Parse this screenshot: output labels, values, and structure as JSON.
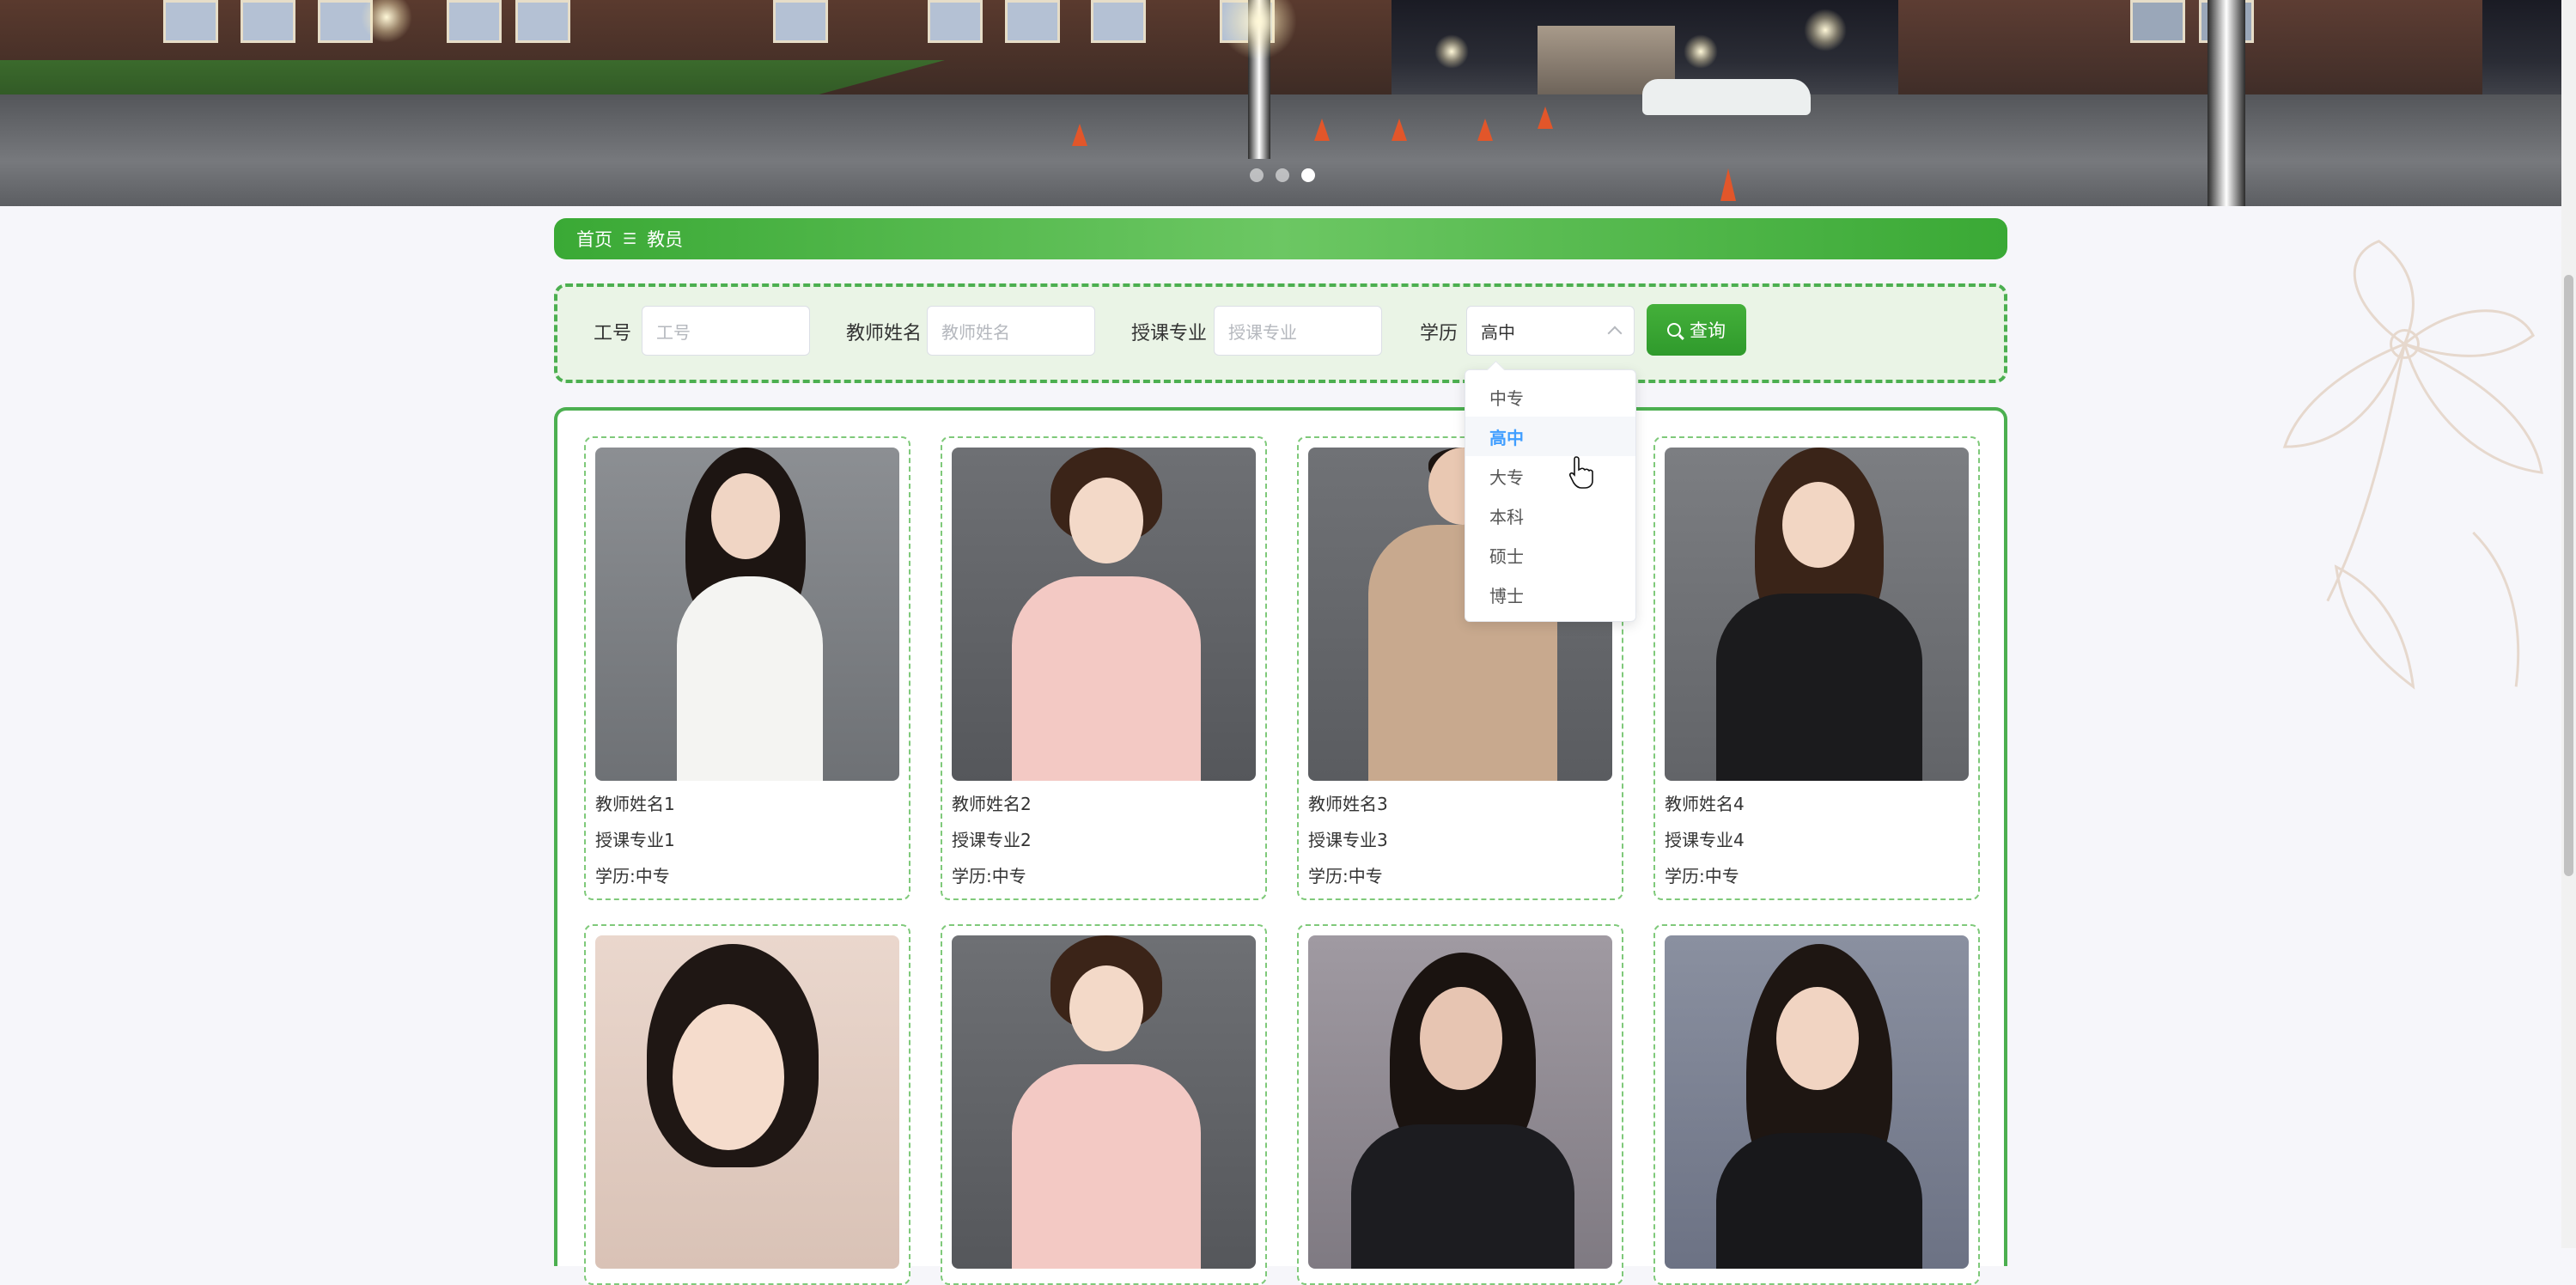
{
  "breadcrumb": {
    "home": "首页",
    "separator": "☰",
    "current": "教员"
  },
  "search": {
    "fields": [
      {
        "label": "工号",
        "placeholder": "工号"
      },
      {
        "label": "教师姓名",
        "placeholder": "教师姓名"
      },
      {
        "label": "授课专业",
        "placeholder": "授课专业"
      }
    ],
    "education": {
      "label": "学历",
      "value": "高中"
    },
    "button_label": "查询"
  },
  "dropdown": {
    "options": [
      "中专",
      "高中",
      "大专",
      "本科",
      "硕士",
      "博士"
    ],
    "selected": "高中"
  },
  "teachers": [
    {
      "name": "教师姓名1",
      "major": "授课专业1",
      "education": "学历:中专"
    },
    {
      "name": "教师姓名2",
      "major": "授课专业2",
      "education": "学历:中专"
    },
    {
      "name": "教师姓名3",
      "major": "授课专业3",
      "education": "学历:中专"
    },
    {
      "name": "教师姓名4",
      "major": "授课专业4",
      "education": "学历:中专"
    },
    {
      "name": "",
      "major": "",
      "education": ""
    },
    {
      "name": "",
      "major": "",
      "education": ""
    },
    {
      "name": "",
      "major": "",
      "education": ""
    },
    {
      "name": "",
      "major": "",
      "education": ""
    }
  ],
  "colors": {
    "accent_green": "#3aa935",
    "selected_blue": "#409eff"
  }
}
